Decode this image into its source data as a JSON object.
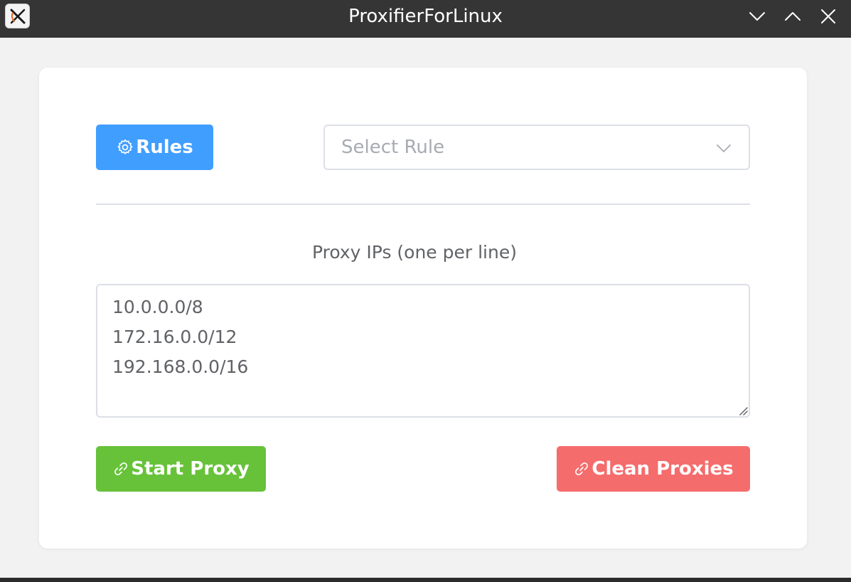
{
  "window": {
    "title": "ProxifierForLinux",
    "icons": {
      "app": "x-app-icon",
      "minimize": "chevron-down-icon",
      "maximize": "chevron-up-icon",
      "close": "close-icon"
    }
  },
  "toolbar": {
    "rules_label": "Rules",
    "rules_icon": "gear-icon",
    "select_placeholder": "Select Rule",
    "select_icon": "chevron-down-icon"
  },
  "proxy": {
    "label": "Proxy IPs (one per line)",
    "value": "10.0.0.0/8\n172.16.0.0/12\n192.168.0.0/16"
  },
  "actions": {
    "start_label": "Start Proxy",
    "clean_label": "Clean Proxies",
    "icon": "link-icon"
  },
  "colors": {
    "primary": "#409eff",
    "success": "#67c23a",
    "danger": "#f56c6c",
    "titlebar": "#353535",
    "text": "#606266",
    "placeholder": "#a8abb2",
    "border": "#dcdfe6"
  }
}
